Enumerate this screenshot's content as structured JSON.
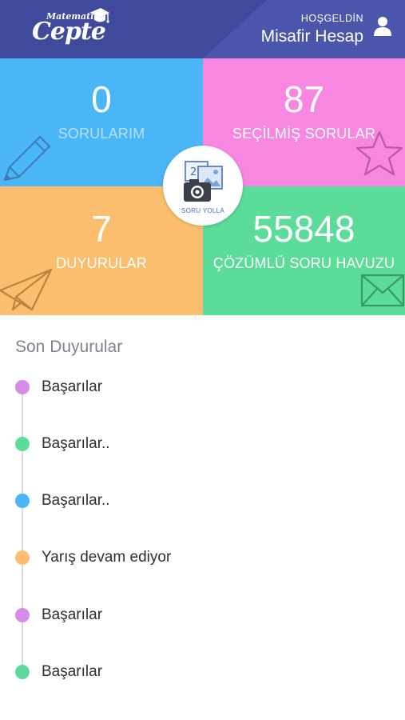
{
  "header": {
    "logo_small": "Matematik",
    "logo_big": "Cepte",
    "welcome": "HOŞGELDİN",
    "user_name": "Misafir Hesap",
    "user_icon": "user-icon",
    "background": "#3f4a9c"
  },
  "tiles": [
    {
      "value": "0",
      "label": "SORULARIM",
      "color": "#4ab6f7",
      "icon": "pencil-icon"
    },
    {
      "value": "87",
      "label": "SEÇİLMİŞ SORULAR",
      "color": "#f787e1",
      "icon": "star-icon"
    },
    {
      "value": "7",
      "label": "DUYURULAR",
      "color": "#fbbe6e",
      "icon": "paper-plane-icon"
    },
    {
      "value": "55848",
      "label": "ÇÖZÜMLÜ SORU HAVUZU",
      "color": "#5bdc98",
      "icon": "envelope-icon"
    }
  ],
  "camera_button": {
    "label": "SORU YOLLA",
    "icon": "camera-photo-icon"
  },
  "announcements": {
    "title": "Son Duyurular",
    "items": [
      {
        "text": "Başarılar",
        "dot_color": "#d58be8"
      },
      {
        "text": "Başarılar..",
        "dot_color": "#5bdc98"
      },
      {
        "text": "Başarılar..",
        "dot_color": "#4ab6f7"
      },
      {
        "text": "Yarış devam ediyor",
        "dot_color": "#fbbe6e"
      },
      {
        "text": "Başarılar",
        "dot_color": "#d58be8"
      },
      {
        "text": "Başarılar",
        "dot_color": "#5bdc98"
      }
    ]
  }
}
